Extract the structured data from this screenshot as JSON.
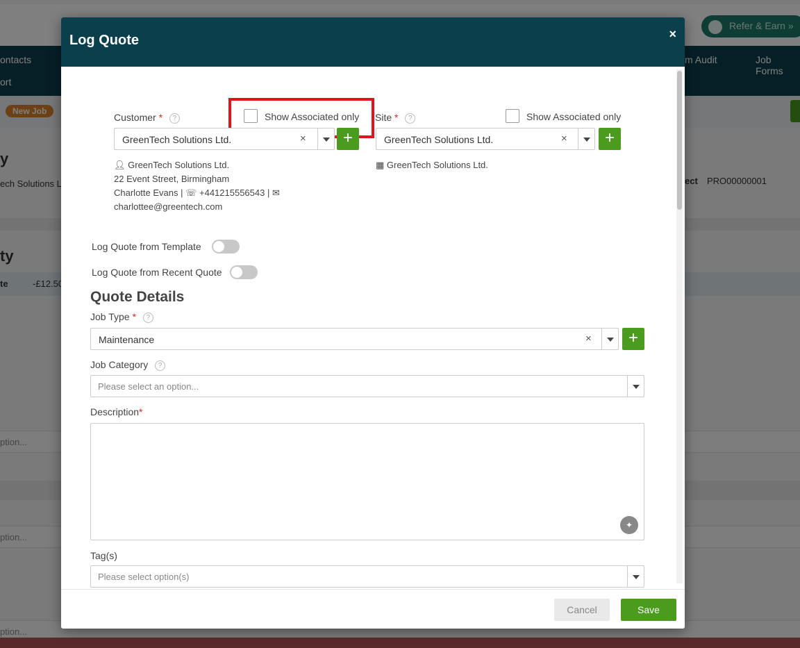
{
  "background": {
    "refer_label": "Refer & Earn",
    "nav_items": [
      "ontacts",
      "m Audit",
      "Job Forms",
      "ort"
    ],
    "new_job_badge": "New Job",
    "left_fragments": [
      "y",
      "ech Solutions L",
      "ty",
      "te",
      "-£12.50"
    ],
    "project_label": "ect",
    "project_code": "PRO00000001",
    "row_placeholders": [
      "ption...",
      "ption...",
      "ption..."
    ]
  },
  "modal": {
    "title": "Log Quote",
    "close": "×",
    "customer": {
      "label": "Customer",
      "required": "*",
      "show_associated": "Show Associated only",
      "value": "GreenTech Solutions Ltd.",
      "clear": "×",
      "add": "+",
      "info": {
        "name": "GreenTech Solutions Ltd.",
        "address": "22 Event Street, Birmingham",
        "contact": "Charlotte Evans",
        "phone": "+441215556543",
        "email": "charlottee@greentech.com"
      }
    },
    "site": {
      "label": "Site",
      "required": "*",
      "show_associated": "Show Associated only",
      "value": "GreenTech Solutions Ltd.",
      "clear": "×",
      "add": "+",
      "info_name": "GreenTech Solutions Ltd."
    },
    "toggles": {
      "template": "Log Quote from Template",
      "recent": "Log Quote from Recent Quote"
    },
    "section_title": "Quote Details",
    "job_type": {
      "label": "Job Type",
      "required": "*",
      "value": "Maintenance",
      "clear": "×",
      "add": "+"
    },
    "job_category": {
      "label": "Job Category",
      "placeholder": "Please select an option..."
    },
    "description": {
      "label": "Description",
      "required": "*"
    },
    "tags": {
      "label": "Tag(s)",
      "placeholder": "Please select option(s)"
    },
    "footer": {
      "cancel": "Cancel",
      "save": "Save"
    }
  }
}
